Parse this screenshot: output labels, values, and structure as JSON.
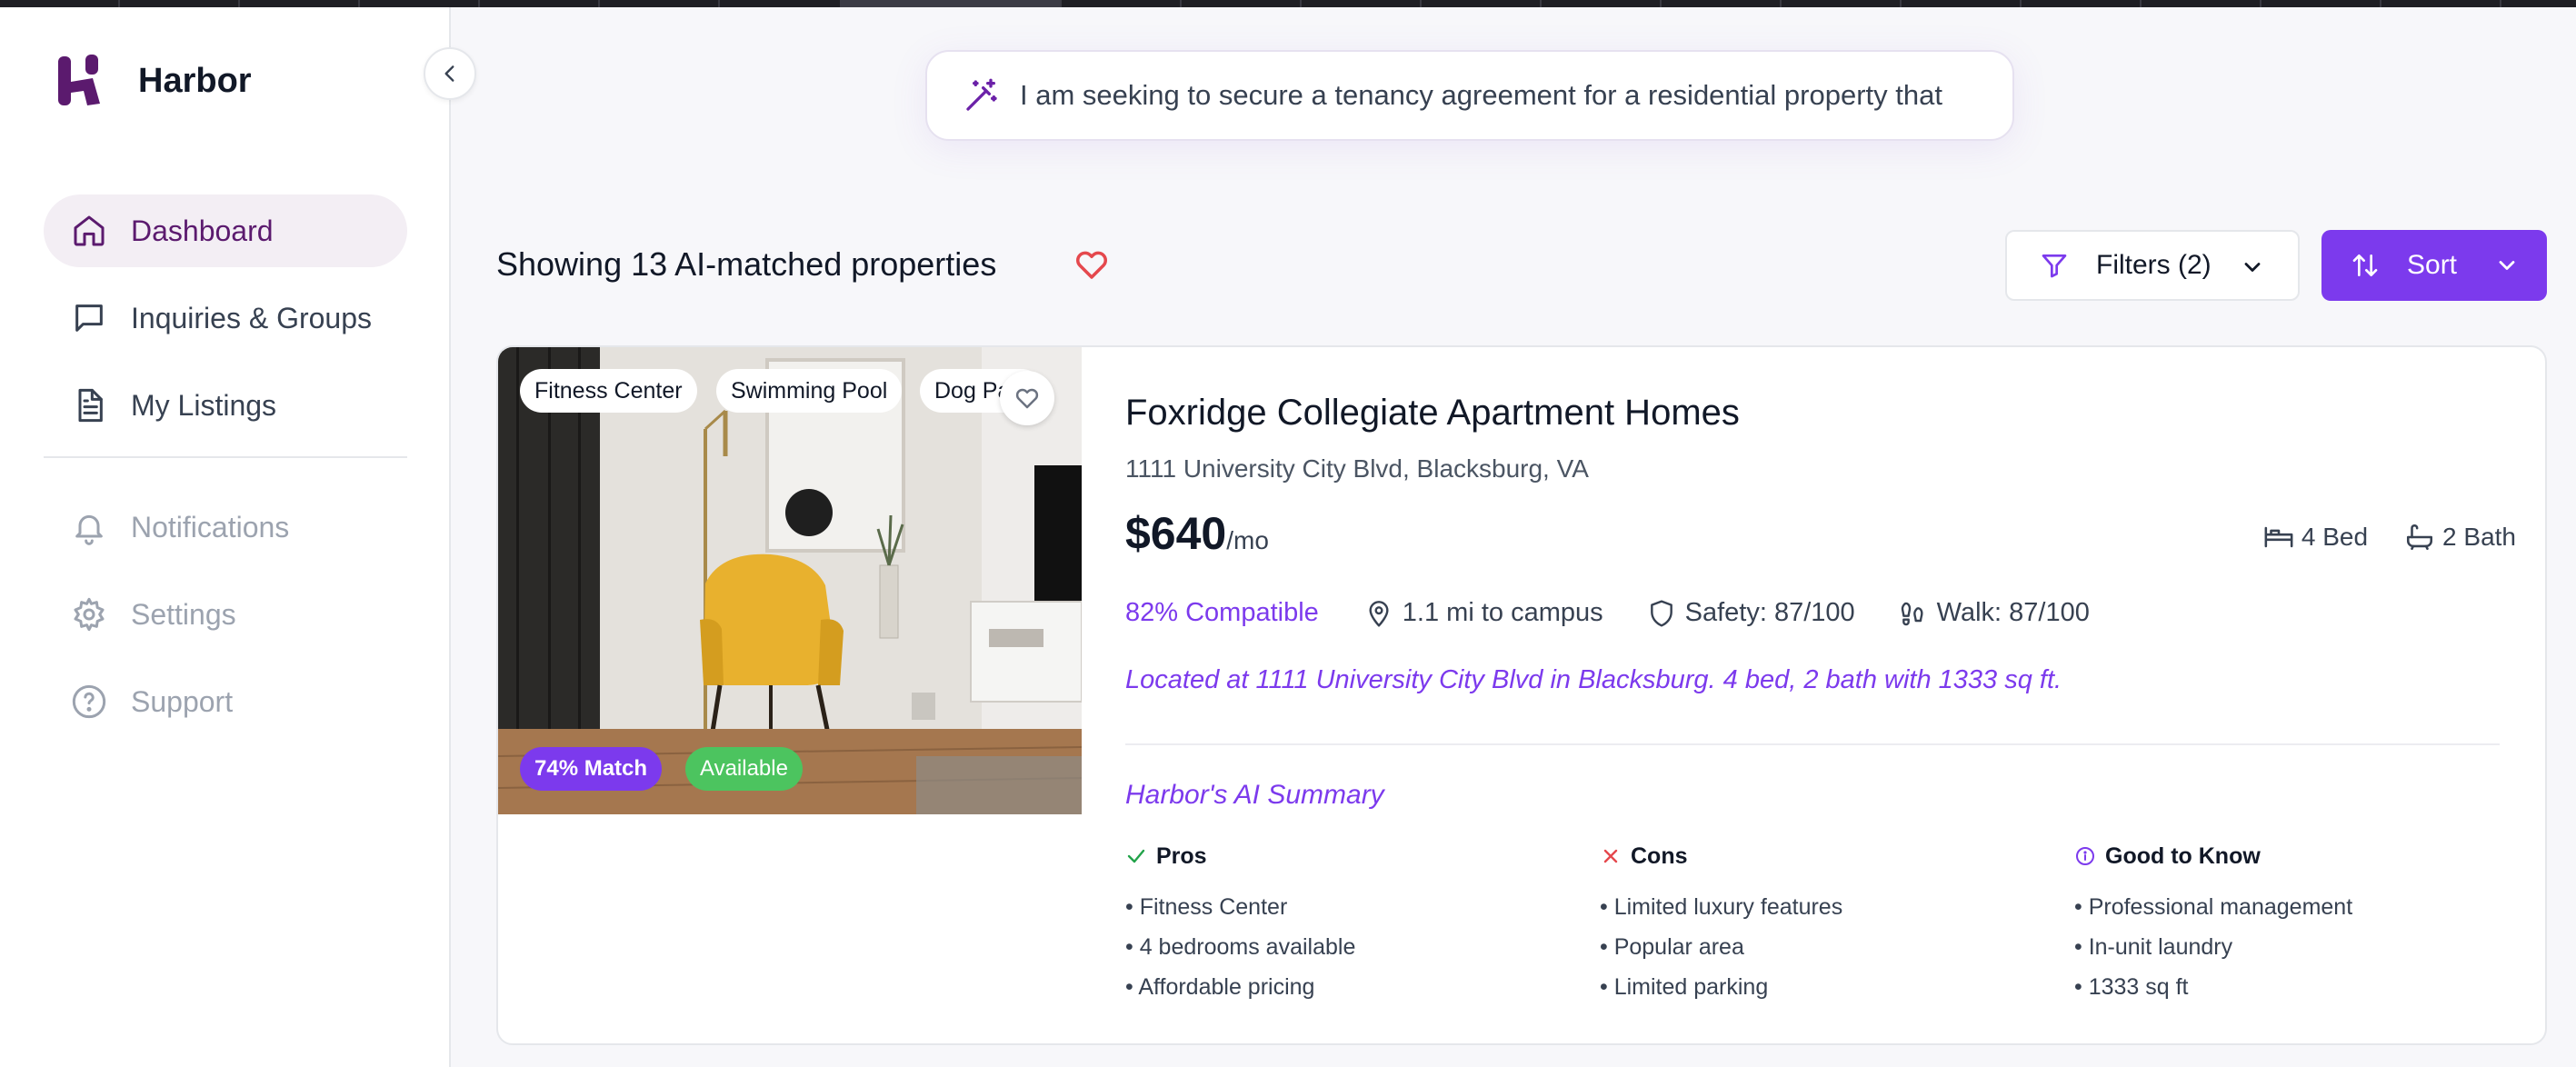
{
  "app": {
    "name": "Harbor"
  },
  "sidebar": {
    "items": [
      {
        "label": "Dashboard",
        "icon": "home-icon",
        "active": true
      },
      {
        "label": "Inquiries & Groups",
        "icon": "chat-icon"
      },
      {
        "label": "My Listings",
        "icon": "document-icon"
      },
      {
        "label": "Notifications",
        "icon": "bell-icon",
        "muted": true
      },
      {
        "label": "Settings",
        "icon": "gear-icon",
        "muted": true
      },
      {
        "label": "Support",
        "icon": "help-circle-icon",
        "muted": true
      }
    ]
  },
  "search": {
    "query": "I am seeking to secure a tenancy agreement for a residential property that",
    "icon": "magic-wand-icon"
  },
  "results": {
    "title": "Showing 13 AI-matched properties",
    "filters_label": "Filters (2)",
    "sort_label": "Sort"
  },
  "listing": {
    "title": "Foxridge Collegiate Apartment Homes",
    "address": "1111 University City Blvd, Blacksburg, VA",
    "price": "$640",
    "price_unit": "/mo",
    "beds": "4 Bed",
    "baths": "2 Bath",
    "compatibility": "82% Compatible",
    "distance": "1.1 mi to campus",
    "safety": "Safety: 87/100",
    "walk": "Walk: 87/100",
    "description": "Located at 1111 University City Blvd in Blacksburg. 4 bed, 2 bath with 1333 sq ft.",
    "amenities": [
      "Fitness Center",
      "Swimming Pool",
      "Dog Park"
    ],
    "match_badge": "74% Match",
    "status_badge": "Available",
    "ai_summary_title": "Harbor's AI Summary",
    "pros_title": "Pros",
    "pros": [
      "Fitness Center",
      "4 bedrooms available",
      "Affordable pricing"
    ],
    "cons_title": "Cons",
    "cons": [
      "Limited luxury features",
      "Popular area",
      "Limited parking"
    ],
    "know_title": "Good to Know",
    "know": [
      "Professional management",
      "In-unit laundry",
      "1333 sq ft"
    ]
  },
  "colors": {
    "accent": "#7c3aed",
    "brand": "#5b1a6e",
    "available": "#4cc45f",
    "favorite": "#e5484d"
  }
}
